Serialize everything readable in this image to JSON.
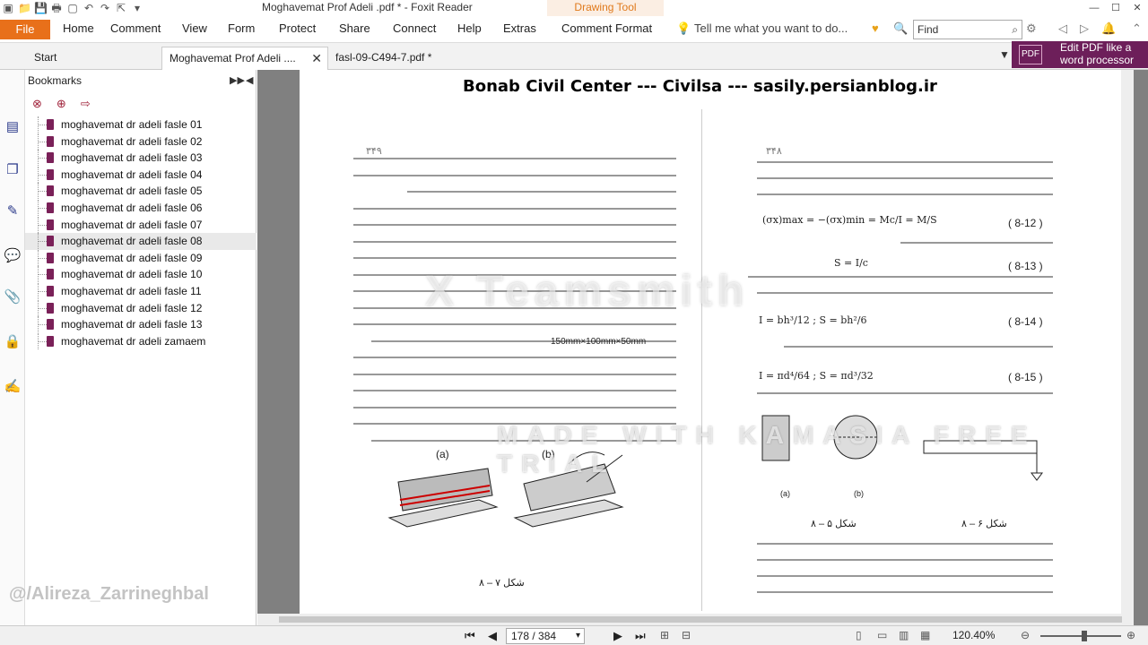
{
  "window": {
    "title": "Moghavemat Prof Adeli .pdf * - Foxit Reader",
    "context_tab": "Drawing Tool",
    "controls": [
      "—",
      "☐",
      "✕"
    ]
  },
  "ribbon": {
    "file": "File",
    "tabs": [
      "Home",
      "Comment",
      "View",
      "Form",
      "Protect",
      "Share",
      "Connect",
      "Help",
      "Extras",
      "Comment Format"
    ],
    "tell_me": "Tell me what you want to do...",
    "find_placeholder": "Find"
  },
  "doc_tabs": [
    {
      "label": "Start"
    },
    {
      "label": "Moghavemat Prof Adeli ...."
    },
    {
      "label": "fasl-09-C494-7.pdf *"
    }
  ],
  "promo": {
    "line1": "Edit PDF like a",
    "line2": "word processor"
  },
  "bookmarks": {
    "title": "Bookmarks",
    "items": [
      "moghavemat dr adeli fasle 01",
      "moghavemat dr adeli fasle 02",
      "moghavemat dr adeli fasle 03",
      "moghavemat dr adeli fasle 04",
      "moghavemat dr adeli fasle 05",
      "moghavemat dr adeli fasle 06",
      "moghavemat dr adeli fasle 07",
      "moghavemat dr adeli fasle 08",
      "moghavemat dr adeli fasle 09",
      "moghavemat dr adeli fasle 10",
      "moghavemat dr adeli fasle 11",
      "moghavemat dr adeli fasle 12",
      "moghavemat dr adeli fasle 13",
      "moghavemat dr adeli zamaem"
    ],
    "selected_index": 7
  },
  "document": {
    "header": "Bonab Civil Center --- Civilsa --- sasily.persianblog.ir",
    "page_num_left": "۳۴۹",
    "page_num_right": "۳۴۸",
    "fig_labels": [
      "(a)",
      "(b)",
      "(a)",
      "(b)"
    ],
    "fig_caption_left": "شکل ۷ – ۸",
    "fig_caption_right1": "شکل ۵ – ۸",
    "fig_caption_right2": "شکل ۶ – ۸",
    "equations": [
      {
        "formula": "(σx)max = −(σx)min = Mc/I = M/S",
        "label": "( 8-12 )"
      },
      {
        "formula": "S = I/c",
        "label": "( 8-13 )"
      },
      {
        "formula": "I = bh³/12   ;   S = bh²/6",
        "label": "( 8-14 )"
      },
      {
        "formula": "I = πd⁴/64   ;   S = πd³/32",
        "label": "( 8-15 )"
      }
    ],
    "dims": {
      "inline1": "150mm×100mm×50mm"
    }
  },
  "watermarks": {
    "main": "X Teamsmith",
    "made_with": "MADE WITH KAMASIA FREE TRIAL",
    "credit": "@/Alireza_Zarrineghbal"
  },
  "status": {
    "page_display": "178 / 384",
    "zoom": "120.40%"
  }
}
